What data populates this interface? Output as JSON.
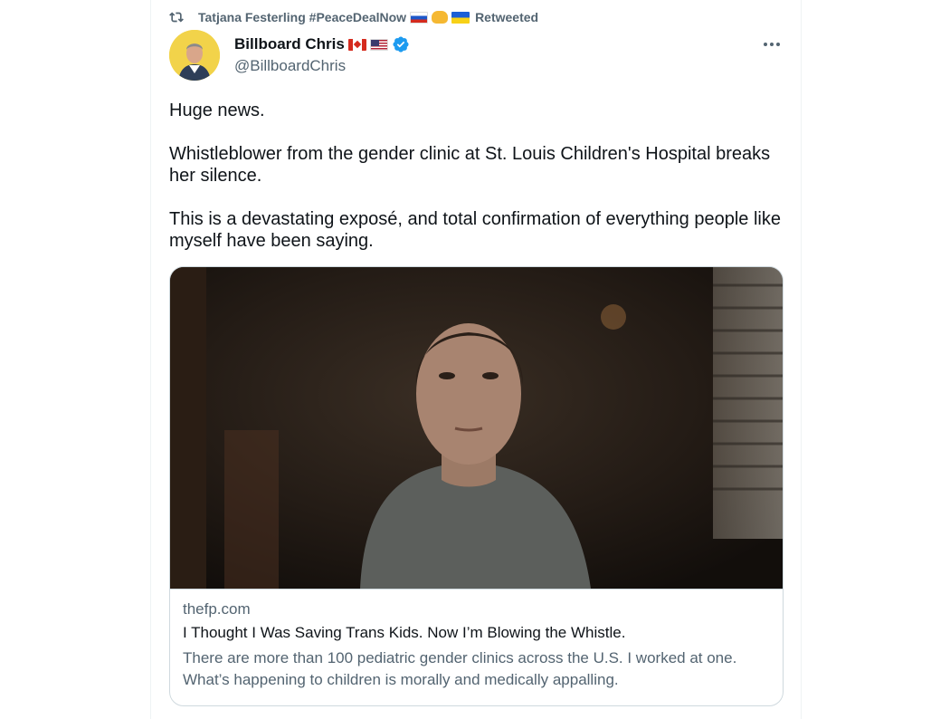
{
  "retweet": {
    "user": "Tatjana Festerling #PeaceDealNow",
    "suffix": "Retweeted"
  },
  "author": {
    "display_name": "Billboard Chris",
    "handle": "@BillboardChris",
    "verified": true
  },
  "tweet": {
    "paragraphs": [
      "Huge news.",
      "Whistleblower from the gender clinic at St. Louis Children's Hospital breaks her silence.",
      "This is a devastating exposé, and total confirmation of everything people like myself have been saying."
    ]
  },
  "card": {
    "domain": "thefp.com",
    "title": "I Thought I Was Saving Trans Kids. Now I’m Blowing the Whistle.",
    "description": "There are more than 100 pediatric gender clinics across the U.S. I worked at one. What’s happening to children is morally and medically appalling."
  },
  "colors": {
    "primary_text": "#0f1419",
    "secondary_text": "#536471",
    "border": "#cfd9de",
    "verified_blue": "#1d9bf0"
  },
  "icons": [
    "retweet-icon",
    "verified-badge-icon",
    "more-options-icon"
  ]
}
